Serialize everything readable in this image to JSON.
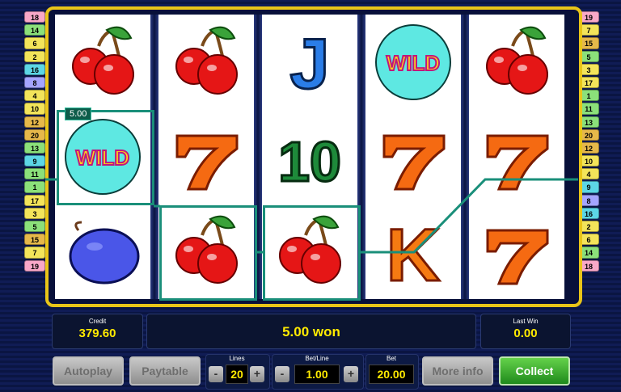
{
  "paylines_left": [
    {
      "num": "18",
      "color": "#f9a8c8"
    },
    {
      "num": "14",
      "color": "#8be07a"
    },
    {
      "num": "6",
      "color": "#f3e45a"
    },
    {
      "num": "2",
      "color": "#f3e45a"
    },
    {
      "num": "16",
      "color": "#5cd6e6"
    },
    {
      "num": "8",
      "color": "#a4a4ff"
    },
    {
      "num": "4",
      "color": "#f3e45a"
    },
    {
      "num": "10",
      "color": "#f3e45a"
    },
    {
      "num": "12",
      "color": "#e6b84a"
    },
    {
      "num": "20",
      "color": "#e6b84a"
    },
    {
      "num": "13",
      "color": "#8be07a"
    },
    {
      "num": "9",
      "color": "#5cd6e6"
    },
    {
      "num": "11",
      "color": "#8be07a"
    },
    {
      "num": "1",
      "color": "#8be07a"
    },
    {
      "num": "17",
      "color": "#f3e45a"
    },
    {
      "num": "3",
      "color": "#f3e45a"
    },
    {
      "num": "5",
      "color": "#8be07a"
    },
    {
      "num": "15",
      "color": "#e6b84a"
    },
    {
      "num": "7",
      "color": "#f3e45a"
    },
    {
      "num": "19",
      "color": "#f9a8c8"
    }
  ],
  "paylines_right": [
    {
      "num": "19",
      "color": "#f9a8c8"
    },
    {
      "num": "7",
      "color": "#f3e45a"
    },
    {
      "num": "15",
      "color": "#e6b84a"
    },
    {
      "num": "5",
      "color": "#8be07a"
    },
    {
      "num": "3",
      "color": "#f3e45a"
    },
    {
      "num": "17",
      "color": "#f3e45a"
    },
    {
      "num": "1",
      "color": "#8be07a"
    },
    {
      "num": "11",
      "color": "#8be07a"
    },
    {
      "num": "13",
      "color": "#8be07a"
    },
    {
      "num": "20",
      "color": "#e6b84a"
    },
    {
      "num": "12",
      "color": "#e6b84a"
    },
    {
      "num": "10",
      "color": "#f3e45a"
    },
    {
      "num": "4",
      "color": "#f3e45a"
    },
    {
      "num": "9",
      "color": "#5cd6e6"
    },
    {
      "num": "8",
      "color": "#a4a4ff"
    },
    {
      "num": "16",
      "color": "#5cd6e6"
    },
    {
      "num": "2",
      "color": "#f3e45a"
    },
    {
      "num": "6",
      "color": "#f3e45a"
    },
    {
      "num": "14",
      "color": "#8be07a"
    },
    {
      "num": "18",
      "color": "#f9a8c8"
    }
  ],
  "reels": [
    [
      "cherry",
      "wild",
      "plum"
    ],
    [
      "cherry",
      "seven",
      "cherry"
    ],
    [
      "jack",
      "ten",
      "cherry"
    ],
    [
      "wild",
      "seven",
      "king"
    ],
    [
      "cherry",
      "seven",
      "seven"
    ]
  ],
  "symbol_text": {
    "wild": "WILD",
    "jack": "J",
    "ten": "10",
    "king": "K"
  },
  "win_badge": "5.00",
  "credit": {
    "label": "Credit",
    "value": "379.60"
  },
  "message": "5.00 won",
  "last_win": {
    "label": "Last Win",
    "value": "0.00"
  },
  "buttons": {
    "autoplay": "Autoplay",
    "paytable": "Paytable",
    "more_info": "More info",
    "collect": "Collect"
  },
  "lines": {
    "label": "Lines",
    "value": "20"
  },
  "bet_line": {
    "label": "Bet/Line",
    "value": "1.00"
  },
  "bet": {
    "label": "Bet",
    "value": "20.00"
  },
  "steppers": {
    "minus": "-",
    "plus": "+"
  },
  "colors": {
    "frame": "#e9c518",
    "win_line": "#1a8f7a",
    "collect": "#2f9a24",
    "amount": "#ffea00"
  }
}
